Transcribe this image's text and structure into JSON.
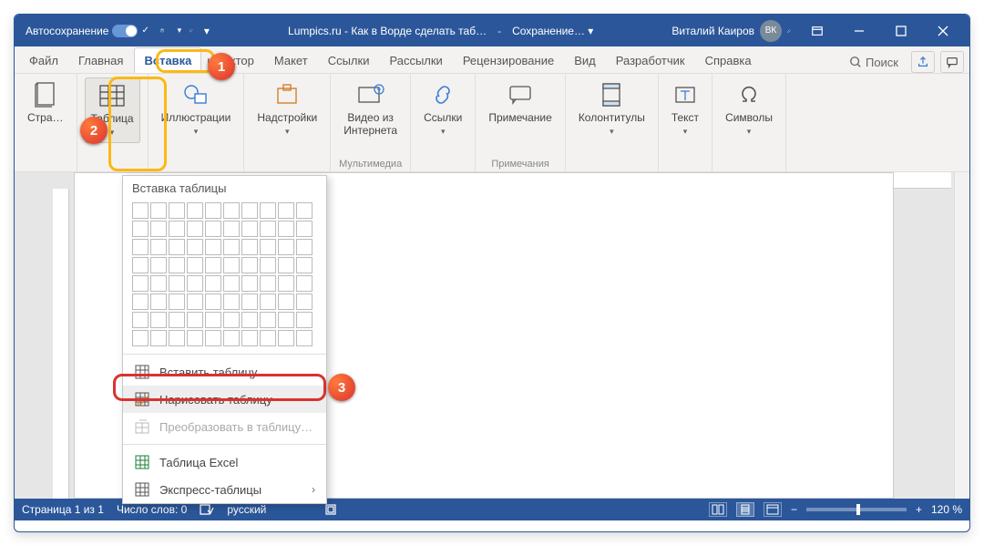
{
  "titlebar": {
    "autosave": "Автосохранение",
    "doc_title": "Lumpics.ru - Как в Ворде сделать таб…",
    "saving": "Сохранение… ▾",
    "user": "Виталий Каиров",
    "avatar": "ВК"
  },
  "tabs": {
    "items": [
      "Файл",
      "Главная",
      "Вставка",
      "Конструктор",
      "Макет",
      "Ссылки",
      "Рассылки",
      "Рецензирование",
      "Вид",
      "Разработчик",
      "Справка"
    ],
    "active_index": 2,
    "search": "Поиск"
  },
  "ribbon": {
    "groups": [
      {
        "label": "",
        "controls": [
          {
            "id": "pages",
            "label": "Стра…"
          }
        ]
      },
      {
        "label": "",
        "controls": [
          {
            "id": "table",
            "label": "Таблица"
          }
        ]
      },
      {
        "label": "",
        "controls": [
          {
            "id": "illustrations",
            "label": "Иллюстрации"
          }
        ]
      },
      {
        "label": "",
        "controls": [
          {
            "id": "addins",
            "label": "Надстройки"
          }
        ]
      },
      {
        "label": "Мультимедиа",
        "controls": [
          {
            "id": "video",
            "label": "Видео из\nИнтернета"
          }
        ]
      },
      {
        "label": "",
        "controls": [
          {
            "id": "links",
            "label": "Ссылки"
          }
        ]
      },
      {
        "label": "Примечания",
        "controls": [
          {
            "id": "comment",
            "label": "Примечание"
          }
        ]
      },
      {
        "label": "",
        "controls": [
          {
            "id": "headers",
            "label": "Колонтитулы"
          }
        ]
      },
      {
        "label": "",
        "controls": [
          {
            "id": "text",
            "label": "Текст"
          }
        ]
      },
      {
        "label": "",
        "controls": [
          {
            "id": "symbols",
            "label": "Символы"
          }
        ]
      }
    ]
  },
  "dropdown": {
    "title": "Вставка таблицы",
    "grid_cols": 10,
    "grid_rows": 8,
    "items": [
      {
        "id": "insert",
        "label": "Вставить таблицу…",
        "disabled": false
      },
      {
        "id": "draw",
        "label": "Нарисовать таблицу",
        "disabled": false
      },
      {
        "id": "convert",
        "label": "Преобразовать в таблицу…",
        "disabled": true
      },
      {
        "id": "excel",
        "label": "Таблица Excel",
        "disabled": false
      },
      {
        "id": "quick",
        "label": "Экспресс-таблицы",
        "disabled": false,
        "submenu": true
      }
    ]
  },
  "statusbar": {
    "page": "Страница 1 из 1",
    "words": "Число слов: 0",
    "lang": "русский",
    "zoom": "120 %"
  },
  "callouts": {
    "b1": "1",
    "b2": "2",
    "b3": "3"
  },
  "colors": {
    "title": "#2b579a"
  }
}
